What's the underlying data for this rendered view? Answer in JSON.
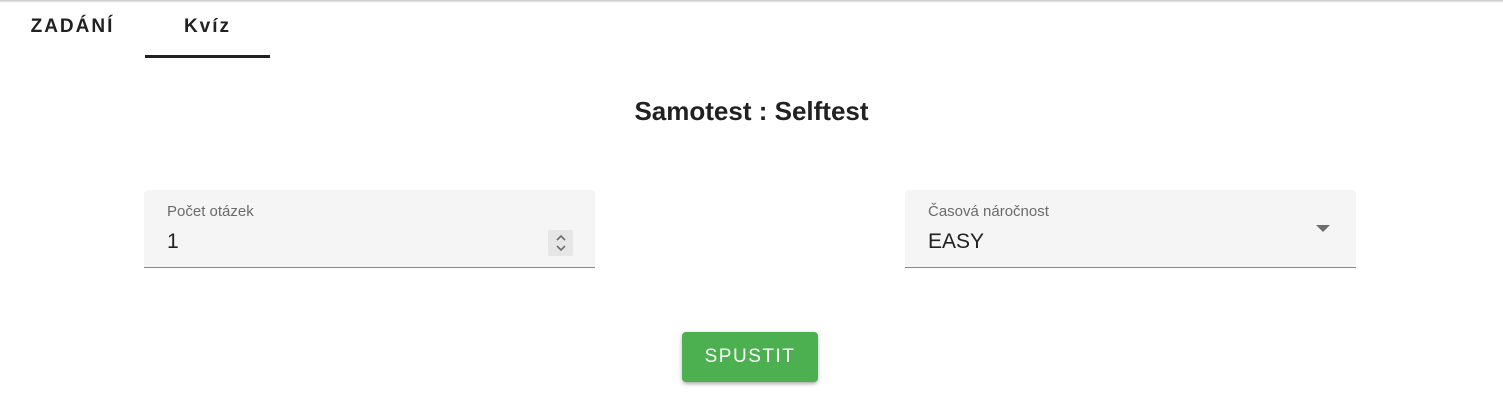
{
  "tabs": [
    {
      "label": "ZADÁNÍ",
      "active": false
    },
    {
      "label": "Kvíz",
      "active": true
    }
  ],
  "quiz": {
    "title": "Samotest : Selftest",
    "question_count": {
      "label": "Počet otázek",
      "value": "1"
    },
    "time_difficulty": {
      "label": "Časová náročnost",
      "value": "EASY"
    },
    "start_label": "SPUSTIT"
  },
  "icons": {
    "spinner": "up-down-chevron-icon",
    "dropdown": "caret-down-icon"
  },
  "colors": {
    "accent_button": "#4caf50",
    "field_background": "#f5f5f5",
    "tab_indicator": "#212121"
  }
}
